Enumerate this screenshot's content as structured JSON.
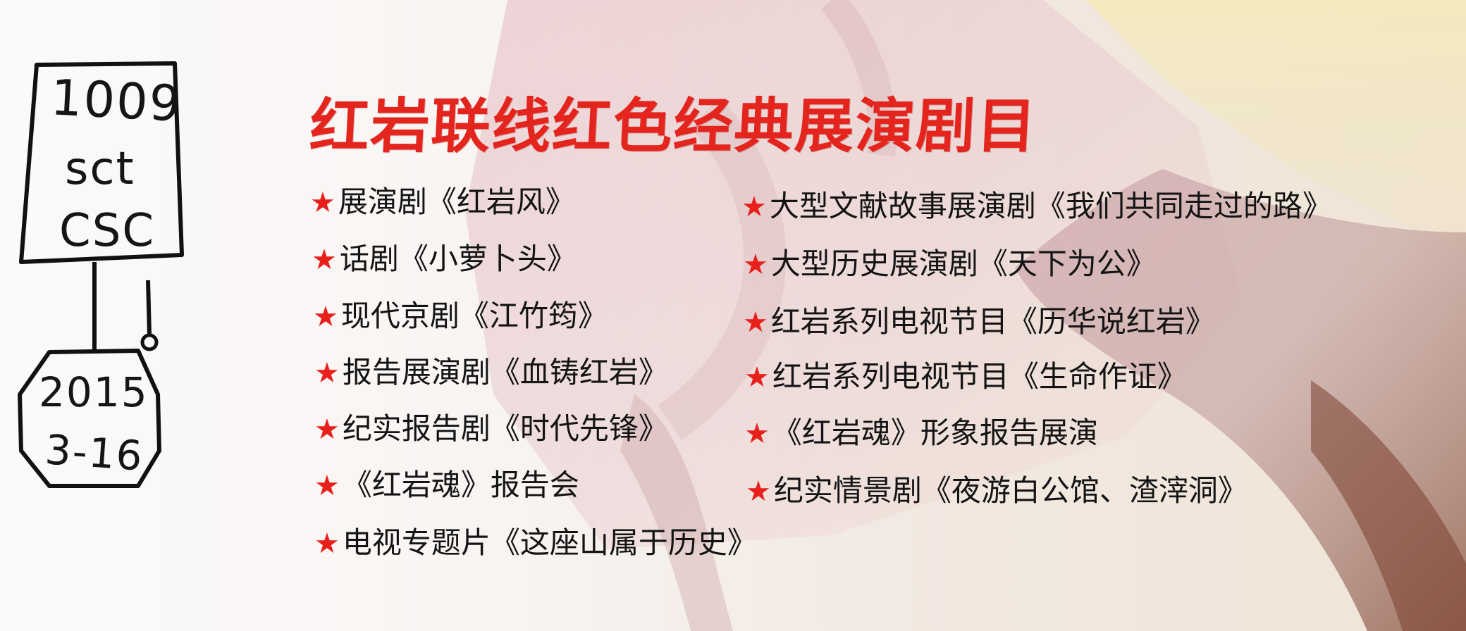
{
  "handwriting": {
    "line1": "1009",
    "line2": "sct",
    "line3": "CSC",
    "date_year": "2015",
    "date_day": "3-16"
  },
  "title": "红岩联线红色经典展演剧目",
  "star_icon": "★",
  "colors": {
    "title": "#e3251e",
    "star": "#e8201b",
    "text": "#141414"
  },
  "left_items": [
    "展演剧《红岩风》",
    "话剧《小萝卜头》",
    "现代京剧《江竹筠》",
    "报告展演剧《血铸红岩》",
    "纪实报告剧《时代先锋》",
    "《红岩魂》报告会",
    "电视专题片《这座山属于历史》"
  ],
  "right_items": [
    "大型文献故事展演剧《我们共同走过的路》",
    "大型历史展演剧《天下为公》",
    "红岩系列电视节目《历华说红岩》",
    "红岩系列电视节目《生命作证》",
    "《红岩魂》形象报告展演",
    "纪实情景剧《夜游白公馆、渣滓洞》"
  ]
}
